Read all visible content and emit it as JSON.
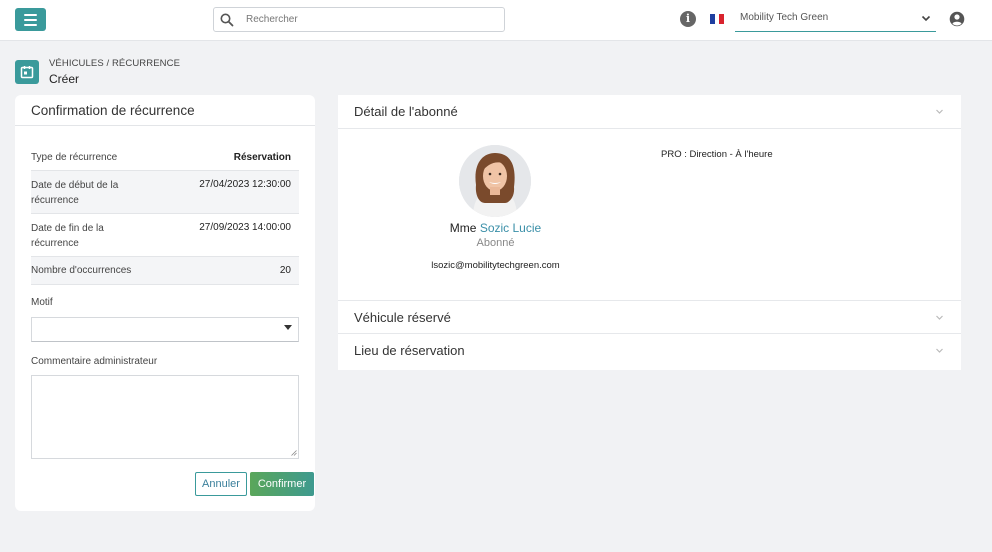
{
  "header": {
    "search_placeholder": "Rechercher",
    "organization": "Mobility Tech Green",
    "icons": [
      "menu-icon",
      "search-icon",
      "info-icon",
      "flag-fr-icon",
      "chevron-down-icon",
      "user-circle-icon"
    ],
    "accent_color": "#3a9a9b"
  },
  "breadcrumb": {
    "path": "VÉHICULES / RÉCURRENCE",
    "title": "Créer"
  },
  "confirmation": {
    "title": "Confirmation de récurrence",
    "rows": [
      {
        "label": "Type de récurrence",
        "value": "Réservation"
      },
      {
        "label": "Date de début de la récurrence",
        "value": "27/04/2023 12:30:00"
      },
      {
        "label": "Date de fin de la récurrence",
        "value": "27/09/2023 14:00:00"
      },
      {
        "label": "Nombre d'occurrences",
        "value": "20"
      }
    ],
    "motif_label": "Motif",
    "motif_value": "",
    "comment_label": "Commentaire administrateur",
    "comment_value": "",
    "cancel_label": "Annuler",
    "confirm_label": "Confirmer"
  },
  "subscriber": {
    "section_title": "Détail de l'abonné",
    "civility": "Mme",
    "name": "Sozic Lucie",
    "role": "Abonné",
    "email": "lsozic@mobilitytechgreen.com",
    "profile": "PRO : Direction - À l'heure"
  },
  "sections": {
    "vehicle": "Véhicule réservé",
    "location": "Lieu de réservation"
  }
}
